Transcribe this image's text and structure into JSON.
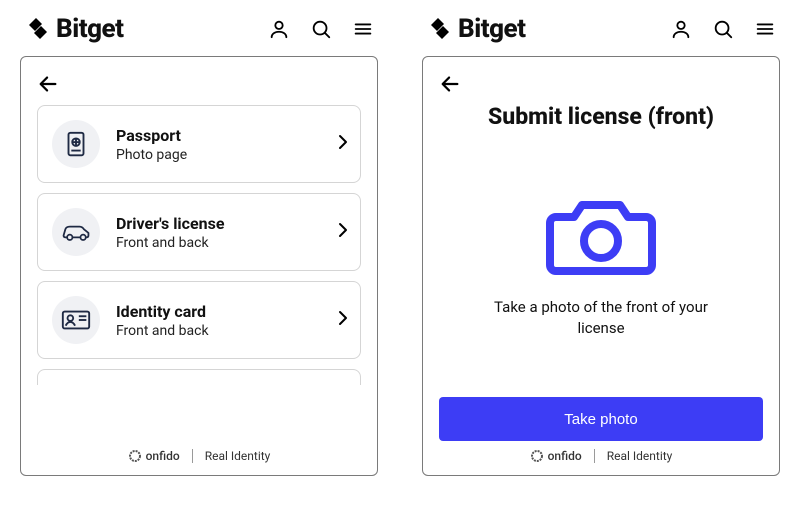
{
  "brand": {
    "name": "Bitget"
  },
  "left": {
    "documents": [
      {
        "title": "Passport",
        "subtitle": "Photo page"
      },
      {
        "title": "Driver's license",
        "subtitle": "Front and back"
      },
      {
        "title": "Identity card",
        "subtitle": "Front and back"
      }
    ]
  },
  "right": {
    "title": "Submit license (front)",
    "instruction": "Take a photo of the front of your license",
    "take_photo_label": "Take photo"
  },
  "footer": {
    "provider": "onfido",
    "tagline": "Real Identity"
  },
  "colors": {
    "primary": "#3d3df5"
  }
}
